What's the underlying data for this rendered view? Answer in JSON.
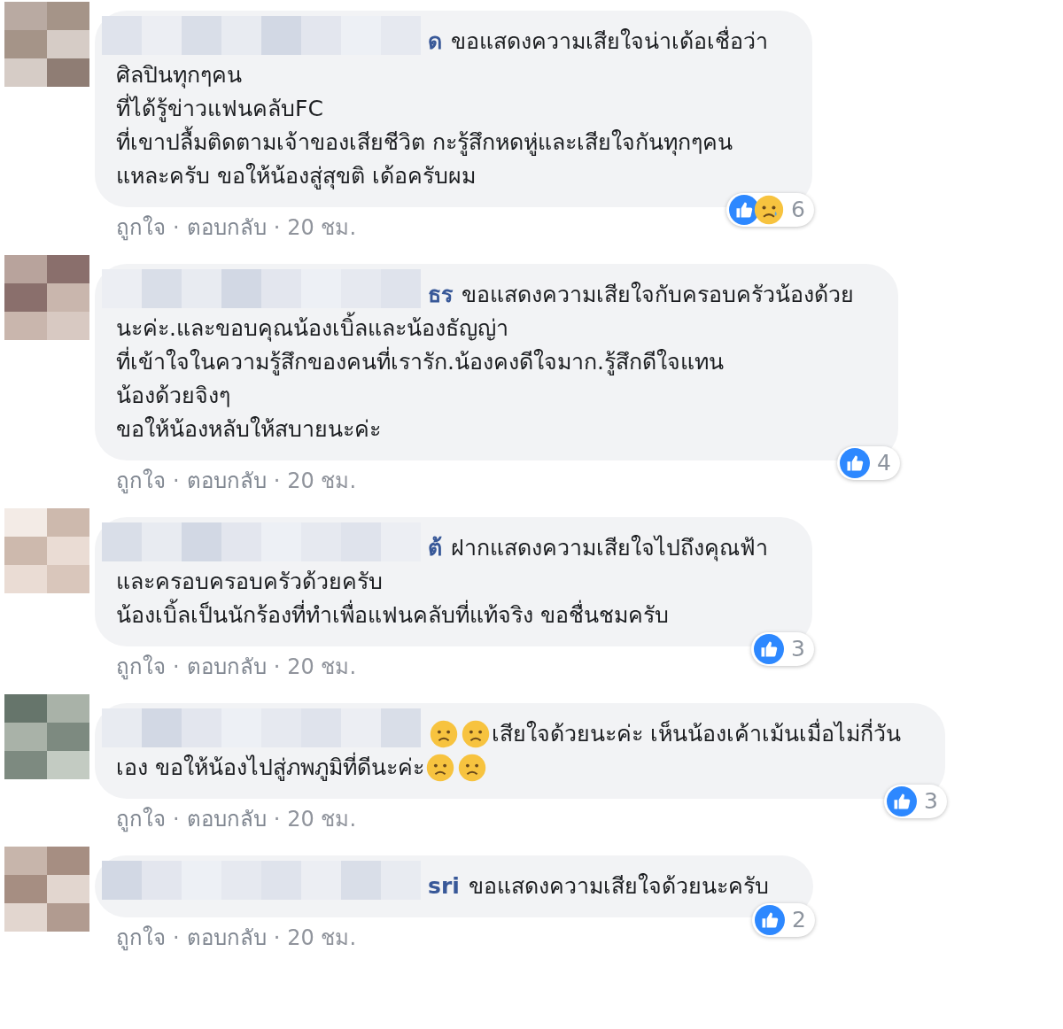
{
  "comments": [
    {
      "name": "ด",
      "lines": [
        [
          {
            "kind": "text",
            "text": "ขอแสดงความเสียใจน่าเด้อเชื่อว่า"
          }
        ],
        [
          {
            "kind": "text",
            "text": "ศิลปินทุกๆคน"
          }
        ],
        [
          {
            "kind": "text",
            "text": "ที่ได้รู้ข่าวแฟนคลับFC"
          }
        ],
        [
          {
            "kind": "text",
            "text": "ที่เขาปลื้มติดตามเจ้าของเสียชีวิต กะรู้สึกหดหู่และเสียใจกันทุกๆคน"
          }
        ],
        [
          {
            "kind": "text",
            "text": "แหละครับ ขอให้น้องสู่สุขติ เด้อครับผม"
          }
        ]
      ],
      "reactions": [
        {
          "kind": "like"
        },
        {
          "kind": "sad"
        }
      ],
      "count": "6",
      "meta": [
        "ถูกใจ",
        "·",
        "ตอบกลับ",
        "·",
        "20 ชม."
      ]
    },
    {
      "name": "ธร",
      "lines": [
        [
          {
            "kind": "text",
            "text": "ขอแสดงความเสียใจกับครอบครัวน้องด้วย"
          }
        ],
        [
          {
            "kind": "text",
            "text": "นะค่ะ.และขอบคุณน้องเบิ้ลและน้องธัญญ่า"
          }
        ],
        [
          {
            "kind": "text",
            "text": "ที่เข้าใจในความรู้สึกของคนที่เรารัก.น้องคงดีใจมาก.รู้สึกดีใจแทน"
          }
        ],
        [
          {
            "kind": "text",
            "text": "น้องด้วยจิงๆ"
          }
        ],
        [
          {
            "kind": "text",
            "text": "ขอให้น้องหลับให้สบายนะค่ะ"
          }
        ]
      ],
      "reactions": [
        {
          "kind": "like"
        }
      ],
      "count": "4",
      "meta": [
        "ถูกใจ",
        "·",
        "ตอบกลับ",
        "·",
        "20 ชม."
      ]
    },
    {
      "name": "ต้",
      "lines": [
        [
          {
            "kind": "text",
            "text": "ฝากแสดงความเสียใจไปถึงคุณฟ้า"
          }
        ],
        [
          {
            "kind": "text",
            "text": "และครอบครอบครัวด้วยครับ"
          }
        ],
        [
          {
            "kind": "text",
            "text": "น้องเบิ้ลเป็นนักร้องที่ทำเพื่อแฟนคลับที่แท้จริง ขอชื่นชมครับ"
          }
        ]
      ],
      "reactions": [
        {
          "kind": "like"
        }
      ],
      "count": "3",
      "meta": [
        "ถูกใจ",
        "·",
        "ตอบกลับ",
        "·",
        "20 ชม."
      ]
    },
    {
      "lines": [
        [
          {
            "kind": "emoji"
          },
          {
            "kind": "emoji"
          },
          {
            "kind": "text",
            "text": "เสียใจด้วยนะค่ะ เห็นน้องเค้าเม้นเมื่อไม่กี่วัน"
          }
        ],
        [
          {
            "kind": "text",
            "text": "เอง ขอให้น้องไปสู่ภพภูมิที่ดีนะค่ะ"
          },
          {
            "kind": "emoji"
          },
          {
            "kind": "emoji"
          }
        ]
      ],
      "reactions": [
        {
          "kind": "like"
        }
      ],
      "count": "3",
      "meta": [
        "ถูกใจ",
        "·",
        "ตอบกลับ",
        "·",
        "20 ชม."
      ]
    },
    {
      "name": "sri",
      "lines": [
        [
          {
            "kind": "text",
            "text": "ขอแสดงความเสียใจด้วยนะครับ"
          }
        ]
      ],
      "reactions": [
        {
          "kind": "like"
        }
      ],
      "count": "2",
      "meta": [
        "ถูกใจ",
        "·",
        "ตอบกลับ",
        "·",
        "20 ชม."
      ]
    }
  ]
}
